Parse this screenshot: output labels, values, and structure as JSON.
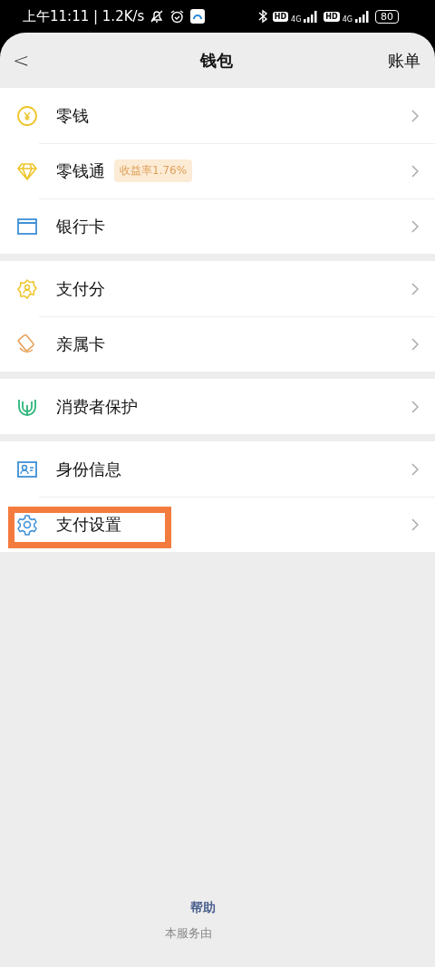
{
  "status_bar": {
    "time": "上午11:11 | 1.2K/s",
    "signals": [
      {
        "hd": "HD",
        "network": "4G"
      },
      {
        "hd": "HD",
        "network": "4G"
      }
    ],
    "battery": "80"
  },
  "nav": {
    "back": "<",
    "title": "钱包",
    "action": "账单"
  },
  "sections": [
    {
      "items": [
        {
          "kind": "coin",
          "label": "零钱",
          "highlighted": false
        },
        {
          "kind": "diamond",
          "label": "零钱通",
          "badge": "收益率1.76%",
          "highlighted": false
        },
        {
          "kind": "card",
          "label": "银行卡",
          "highlighted": false
        }
      ]
    },
    {
      "items": [
        {
          "kind": "score",
          "label": "支付分",
          "highlighted": false
        },
        {
          "kind": "family",
          "label": "亲属卡",
          "highlighted": false
        }
      ]
    },
    {
      "items": [
        {
          "kind": "hands",
          "label": "消费者保护",
          "highlighted": false
        }
      ]
    },
    {
      "items": [
        {
          "kind": "id",
          "label": "身份信息",
          "highlighted": false
        },
        {
          "kind": "gear",
          "label": "支付设置",
          "highlighted": true
        }
      ]
    }
  ],
  "footer": {
    "link": "帮助",
    "note": "本服务由"
  }
}
